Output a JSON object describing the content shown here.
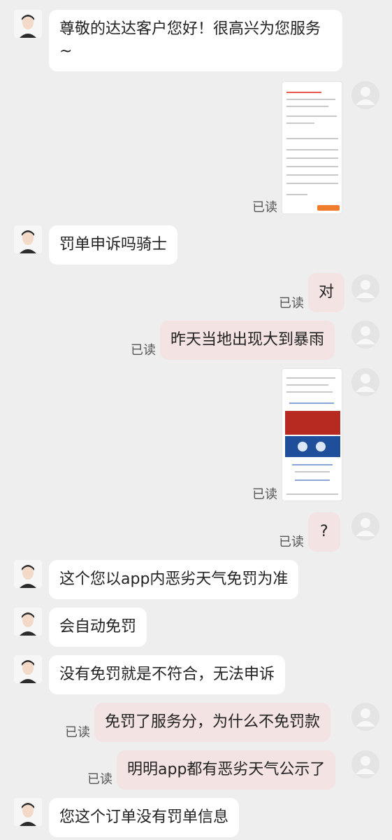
{
  "messages": [
    {
      "text": "尊敬的达达客户您好！很高兴为您服务~"
    },
    {
      "text": "罚单申诉吗骑士"
    },
    {
      "text": "对"
    },
    {
      "text": "昨天当地出现大到暴雨"
    },
    {
      "text": "?"
    },
    {
      "text": "这个您以app内恶劣天气免罚为准"
    },
    {
      "text": "会自动免罚"
    },
    {
      "text": "没有免罚就是不符合，无法申诉"
    },
    {
      "text": "免罚了服务分，为什么不免罚款"
    },
    {
      "text": "明明app都有恶劣天气公示了"
    },
    {
      "text": "您这个订单没有罚单信息"
    }
  ],
  "read_label": "已读",
  "colors": {
    "background": "#eeeeee",
    "incoming_bubble": "#ffffff",
    "outgoing_bubble": "#f3e3e2"
  }
}
